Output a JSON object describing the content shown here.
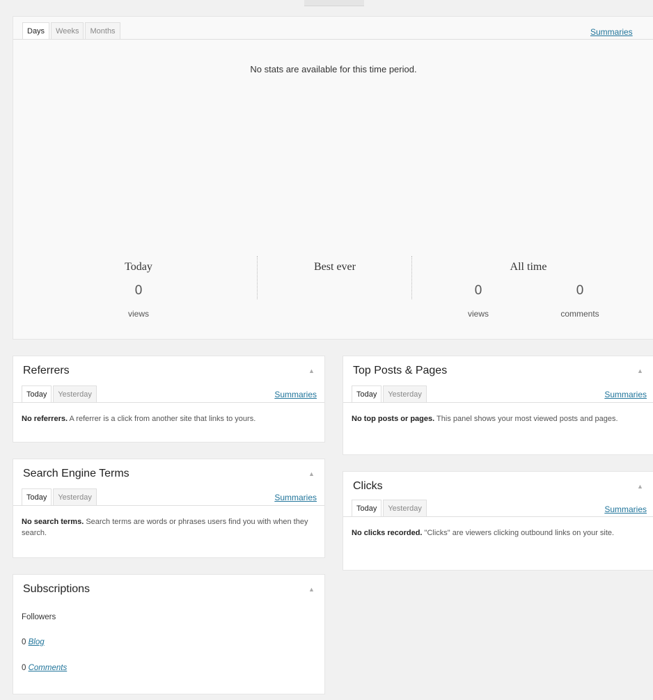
{
  "main": {
    "tabs": [
      "Days",
      "Weeks",
      "Months"
    ],
    "summaries": "Summaries",
    "empty_message": "No stats are available for this time period.",
    "today": {
      "label": "Today",
      "views": "0",
      "views_label": "views"
    },
    "best_ever": {
      "label": "Best ever"
    },
    "all_time": {
      "label": "All time",
      "views": "0",
      "views_label": "views",
      "comments": "0",
      "comments_label": "comments"
    }
  },
  "referrers": {
    "title": "Referrers",
    "tabs": [
      "Today",
      "Yesterday"
    ],
    "summaries": "Summaries",
    "empty_bold": "No referrers.",
    "empty_text": " A referrer is a click from another site that links to yours."
  },
  "top_posts": {
    "title": "Top Posts & Pages",
    "tabs": [
      "Today",
      "Yesterday"
    ],
    "summaries": "Summaries",
    "empty_bold": "No top posts or pages.",
    "empty_text": " This panel shows your most viewed posts and pages."
  },
  "search_terms": {
    "title": "Search Engine Terms",
    "tabs": [
      "Today",
      "Yesterday"
    ],
    "summaries": "Summaries",
    "empty_bold": "No search terms.",
    "empty_text": " Search terms are words or phrases users find you with when they search."
  },
  "clicks": {
    "title": "Clicks",
    "tabs": [
      "Today",
      "Yesterday"
    ],
    "summaries": "Summaries",
    "empty_bold": "No clicks recorded.",
    "empty_text": " \"Clicks\" are viewers clicking outbound links on your site."
  },
  "subscriptions": {
    "title": "Subscriptions",
    "followers_label": "Followers",
    "blog_count": "0",
    "blog_label": "Blog",
    "comments_count": "0",
    "comments_label": "Comments"
  },
  "icons": {
    "collapse": "triangle-up-icon"
  }
}
